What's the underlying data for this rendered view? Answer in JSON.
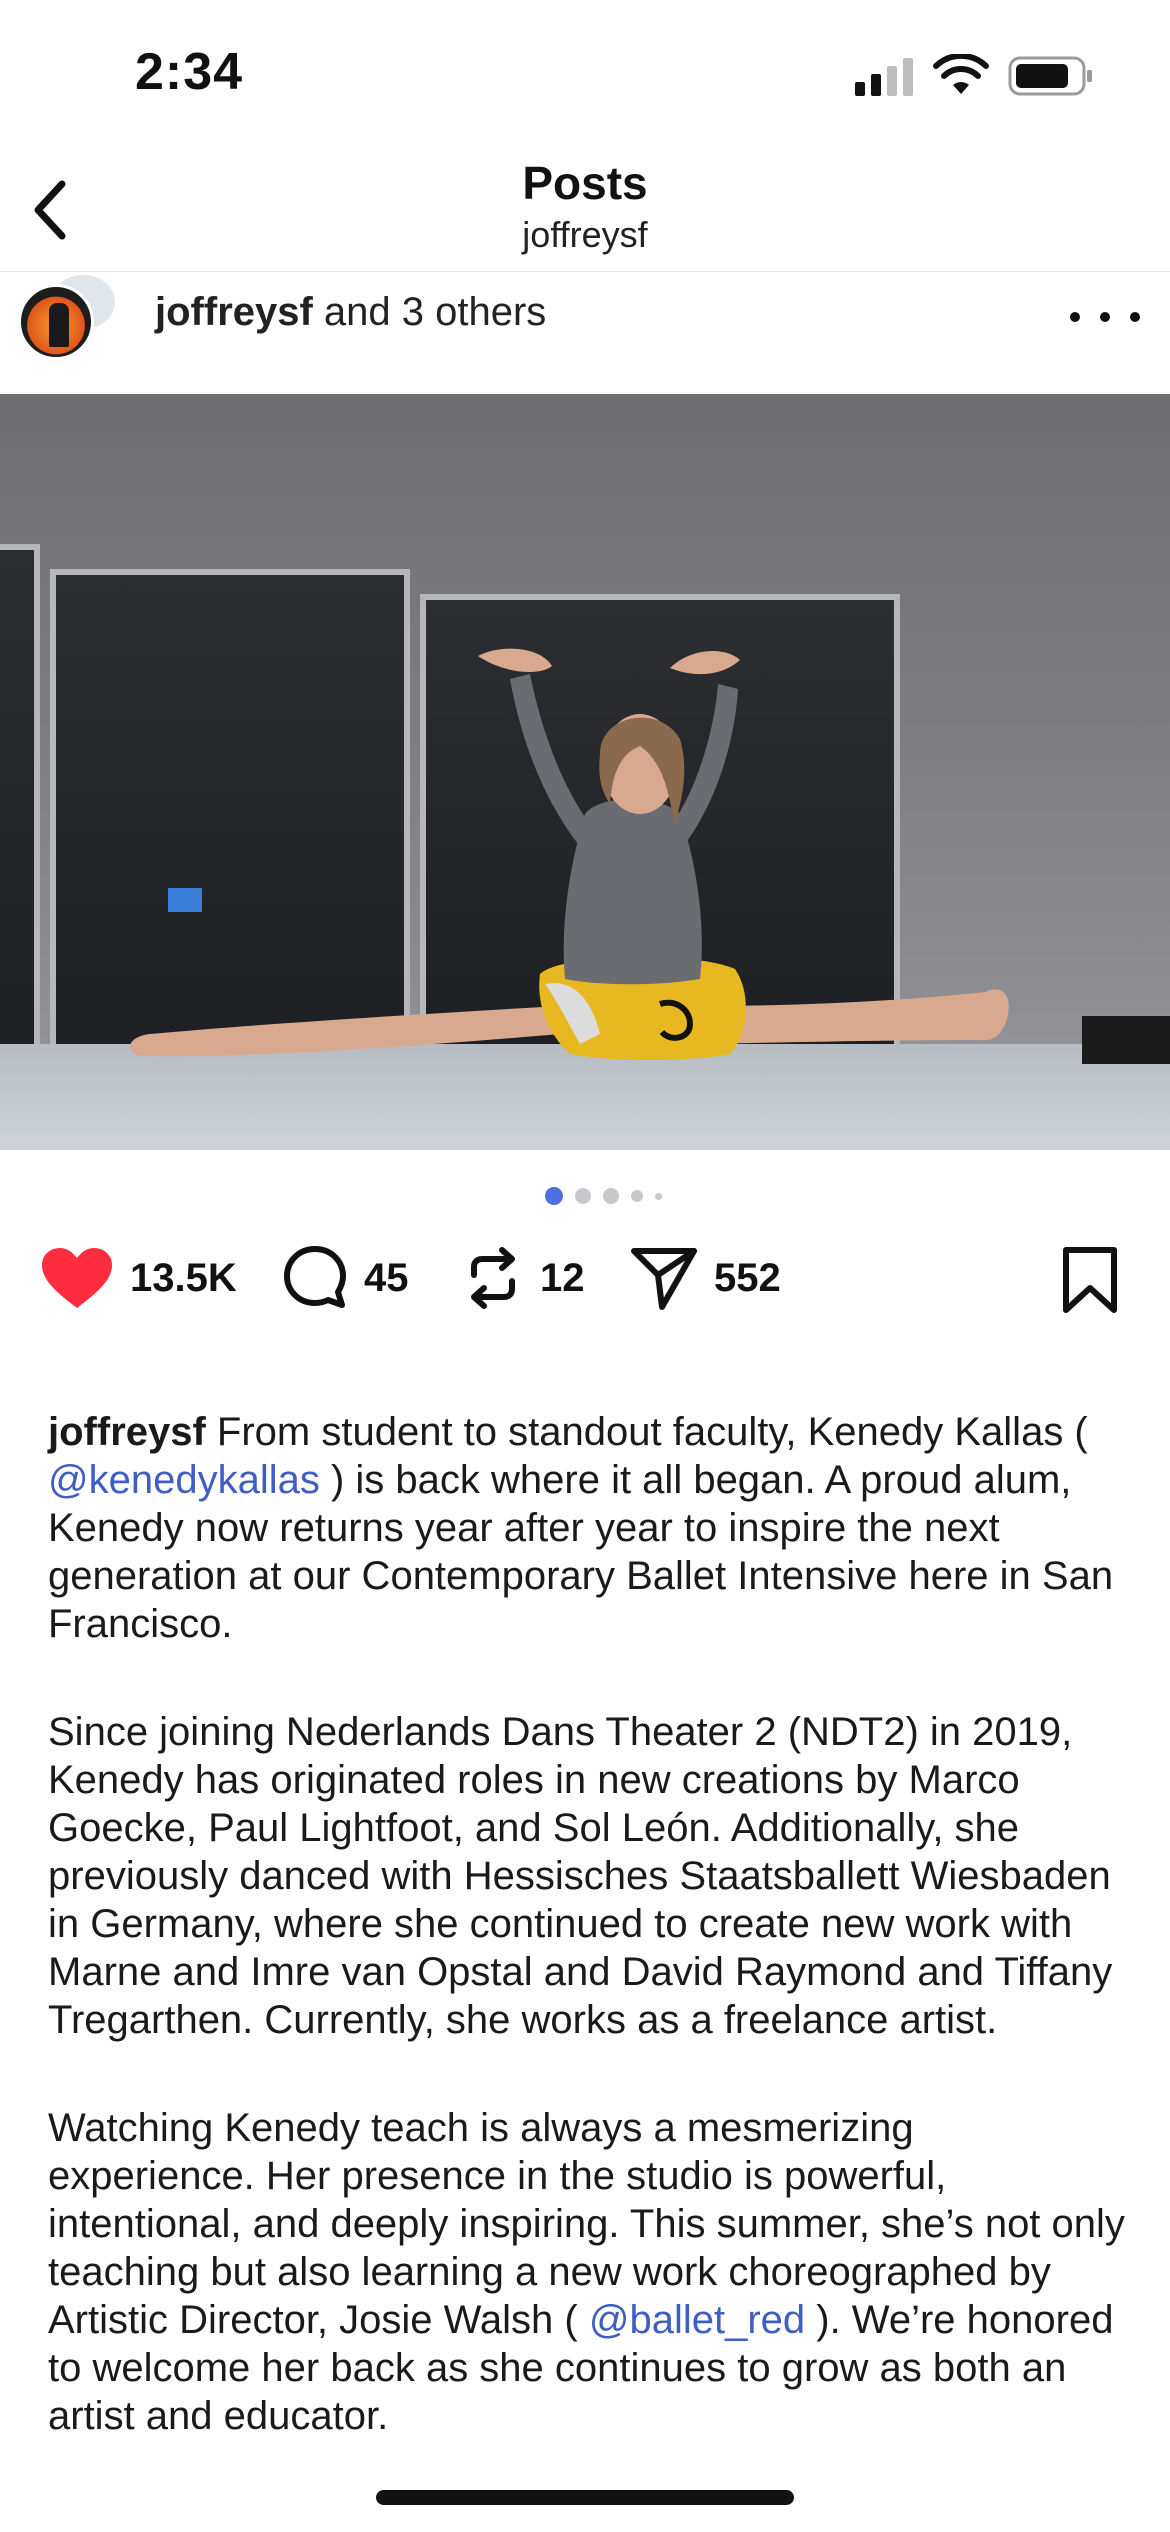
{
  "status_bar": {
    "time": "2:34"
  },
  "nav": {
    "title": "Posts",
    "subtitle": "joffreysf"
  },
  "post": {
    "author": "joffreysf",
    "coauthors_text": " and 3 others",
    "carousel": {
      "count": 5,
      "active_index": 0
    },
    "likes": "13.5K",
    "comments": "45",
    "reposts": "12",
    "shares": "552",
    "caption": {
      "username": "joffreysf",
      "p1_a": " From student to standout faculty, Kenedy Kallas ( ",
      "p1_mention": "@kenedykallas",
      "p1_b": " ) is back where it all began. A proud alum, Kenedy now returns year after year to inspire the next generation at our Contemporary Ballet Intensive here in San Francisco.",
      "p2": "Since joining Nederlands Dans Theater 2 (NDT2) in 2019, Kenedy has originated roles in new creations by Marco Goecke, Paul Lightfoot, and Sol León. Additionally, she previously danced with Hessisches Staatsballett Wiesbaden in Germany, where she continued to create new work with Marne and Imre van Opstal and David Raymond and Tiffany Tregarthen. Currently, she works as a freelance artist.",
      "p3_a": "Watching Kenedy teach is always a mesmerizing experience. Her presence in the studio is powerful, intentional, and deeply inspiring. This summer, she’s not only teaching but also learning a new work choreographed by Artistic Director, Josie Walsh ( ",
      "p3_mention": "@ballet_red",
      "p3_b": " ). We’re honored to welcome her back as she continues to grow as both an artist and educator."
    }
  },
  "colors": {
    "like_red": "#ff2d3f",
    "mention_blue": "#3f5ec5",
    "dot_active": "#4f6fe0",
    "dot_inactive": "#c8c8cc"
  },
  "icons": [
    "cellular-signal-icon",
    "wifi-icon",
    "battery-icon",
    "back-chevron-icon",
    "more-icon",
    "heart-icon",
    "comment-icon",
    "repost-icon",
    "share-icon",
    "bookmark-icon"
  ]
}
